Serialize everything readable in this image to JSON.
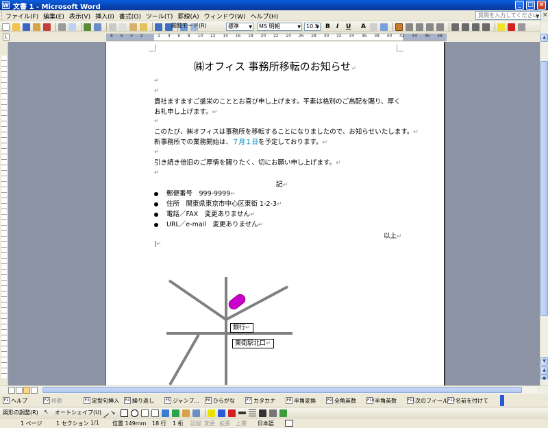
{
  "window": {
    "title": "文書 1 - Microsoft Word",
    "app_icon": "W"
  },
  "menubar": {
    "items": [
      "ファイル(F)",
      "編集(E)",
      "表示(V)",
      "挿入(I)",
      "書式(O)",
      "ツール(T)",
      "罫線(A)",
      "ウィンドウ(W)",
      "ヘルプ(H)"
    ],
    "help_placeholder": "質問を入力してください"
  },
  "toolbar": {
    "reading_mode": "閲覧モード(R)",
    "style": "標準",
    "font": "MS 明朝",
    "font_size": "10.5",
    "bold": "B",
    "italic": "I",
    "underline": "U",
    "char_a": "A"
  },
  "ruler": {
    "numbers": [
      "8",
      "6",
      "4",
      "2",
      "",
      "2",
      "4",
      "6",
      "8",
      "10",
      "12",
      "14",
      "16",
      "18",
      "20",
      "22",
      "24",
      "26",
      "28",
      "30",
      "32",
      "34",
      "36",
      "38",
      "40",
      "42",
      "44",
      "46",
      "48"
    ]
  },
  "document": {
    "title": "㈱オフィス 事務所移転のお知らせ",
    "greeting": "貴社ますますご盛栄のこととお喜び申し上げます。平素は格別のご高配を賜り、厚くお礼申し上げます。",
    "notice_line1": "このたび、㈱オフィスは事務所を移転することになりましたので、お知らせいたします。",
    "notice_line2_pre": "新事務所での業務開始は、",
    "start_date": "７月１日",
    "notice_line2_post": "を予定しております。",
    "closing": "引き続き倍旧のご厚情を賜りたく、切にお願い申し上げます。",
    "ki": "記",
    "items": [
      "郵便番号　999-9999",
      "住所　関東県東京市中心区東街 1-2-3",
      "電話／FAX　変更ありません",
      "URL／e-mail　変更ありません"
    ],
    "ijou": "以上",
    "return_mark": "↵"
  },
  "map": {
    "bank_label": "銀行",
    "station_label": "東街駅北口",
    "road_color": "#808080",
    "marker_color": "#cc00cc"
  },
  "fkeys": [
    {
      "key": "F1",
      "label": "ヘルプ",
      "enabled": true
    },
    {
      "key": "F2",
      "label": "移動",
      "enabled": false
    },
    {
      "key": "F3",
      "label": "定型句挿入",
      "enabled": true
    },
    {
      "key": "F4",
      "label": "繰り返し",
      "enabled": true
    },
    {
      "key": "F5",
      "label": "ジャンプ...",
      "enabled": true
    },
    {
      "key": "F6",
      "label": "ひらがな",
      "enabled": true
    },
    {
      "key": "F7",
      "label": "カタカナ",
      "enabled": true
    },
    {
      "key": "F8",
      "label": "半角変換",
      "enabled": true
    },
    {
      "key": "F9",
      "label": "全角英数",
      "enabled": true
    },
    {
      "key": "F10",
      "label": "半角英数",
      "enabled": true
    },
    {
      "key": "F11",
      "label": "次のフィールド",
      "enabled": true
    },
    {
      "key": "F12",
      "label": "名前を付けて...",
      "enabled": true
    }
  ],
  "drawbar": {
    "adjust": "図形の調整(R)",
    "autoshape": "オートシェイプ(U)"
  },
  "status": {
    "page": "1 ページ",
    "section": "1 セクション",
    "page_of": "1/1",
    "position": "位置 149mm",
    "line": "18 行",
    "column": "1 桁",
    "rec": "記録",
    "trk": "変更",
    "ext": "拡張",
    "ovr": "上書",
    "lang": "日本語"
  },
  "colors": {
    "titlebar": "#0a5fe0",
    "accent_date": "#33a7d1"
  }
}
